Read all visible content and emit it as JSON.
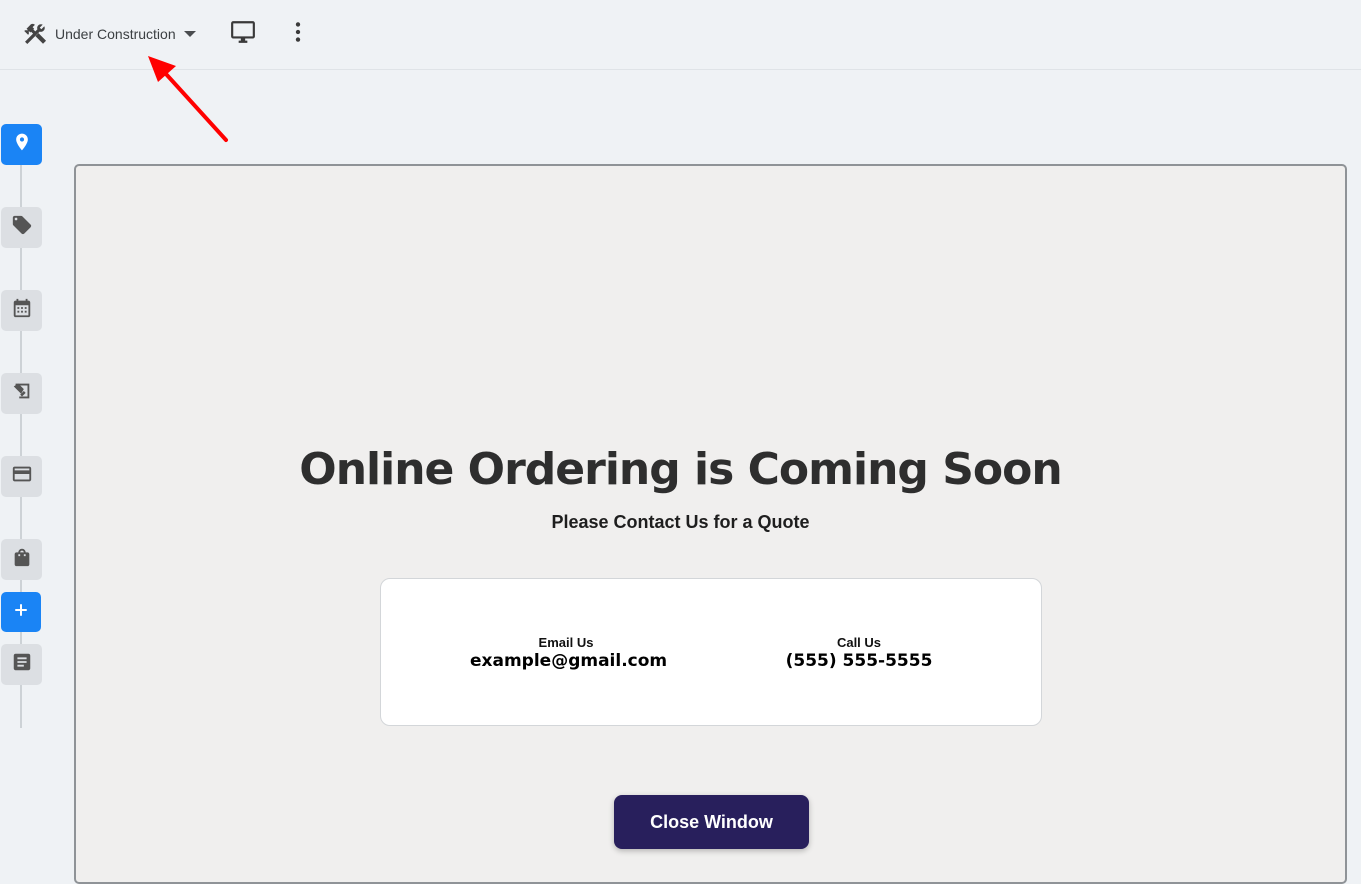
{
  "toolbar": {
    "status_label": "Under Construction",
    "status_icon": "tools-icon",
    "preview_icon": "desktop-icon",
    "more_icon": "more-vert-icon"
  },
  "stepper": {
    "steps": [
      {
        "icon": "location-pin-icon",
        "active": true
      },
      {
        "icon": "tag-icon",
        "active": false
      },
      {
        "icon": "calendar-icon",
        "active": false
      },
      {
        "icon": "design-tool-icon",
        "active": false
      },
      {
        "icon": "credit-card-icon",
        "active": false
      },
      {
        "icon": "shopping-bag-icon",
        "active": false
      },
      {
        "icon": "plus-icon",
        "active": true
      },
      {
        "icon": "document-icon",
        "active": false
      }
    ]
  },
  "preview": {
    "headline": "Online Ordering is Coming Soon",
    "subheadline": "Please Contact Us for a Quote",
    "email_caption": "Email Us",
    "email_value": "example@gmail.com",
    "phone_caption": "Call Us",
    "phone_value": "(555) 555-5555",
    "close_button": "Close Window"
  },
  "colors": {
    "accent": "#1a84f5",
    "button": "#281f5c",
    "annotation": "#ff0000"
  }
}
